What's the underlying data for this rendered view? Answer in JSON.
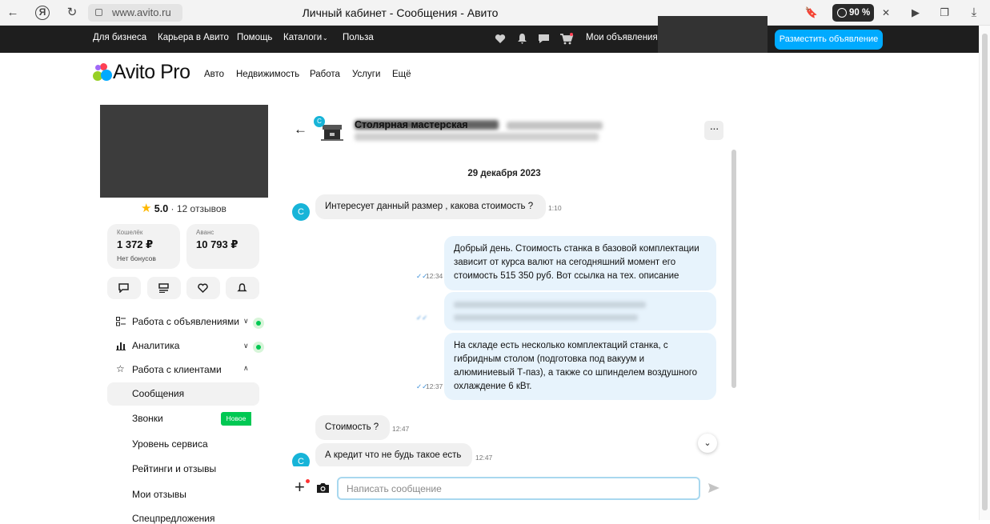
{
  "browser": {
    "url": "www.avito.ru",
    "tab_title": "Личный кабинет - Сообщения - Авито",
    "zoom": "90 %"
  },
  "topnav": {
    "links": [
      "Для бизнеса",
      "Карьера в Авито",
      "Помощь",
      "Каталоги",
      "Польза"
    ],
    "my_ads": "Мои объявления",
    "post_button": "Разместить объявление"
  },
  "header": {
    "logo_text": "Avito Pro",
    "categories": [
      "Авто",
      "Недвижимость",
      "Работа",
      "Услуги",
      "Ещё"
    ]
  },
  "profile": {
    "rating": "5.0",
    "reviews": "12 отзывов",
    "wallet": {
      "label": "Кошелёк",
      "value": "1 372 ₽",
      "sub": "Нет бонусов"
    },
    "advance": {
      "label": "Аванс",
      "value": "10 793 ₽"
    }
  },
  "menu": {
    "ads": "Работа с объявлениями",
    "analytics": "Аналитика",
    "clients": "Работа с клиентами",
    "messages": "Сообщения",
    "calls": "Звонки",
    "new_badge": "Новое",
    "service_level": "Уровень сервиса",
    "ratings": "Рейтинги и отзывы",
    "my_reviews": "Мои отзывы",
    "special": "Спецпредложения"
  },
  "chat": {
    "title": "Столярная мастерская",
    "avatar_letter": "С",
    "date": "29 декабря 2023",
    "messages": [
      {
        "dir": "in",
        "text": "Интересует данный размер , какова стоимость ?",
        "time": "1:10"
      },
      {
        "dir": "out",
        "lines": [
          "Добрый день. Стоимость станка  в базовой комплектации",
          "зависит от курса валют на сегодняшний момент его",
          "стоимость   515 350 руб. Вот  ссылка на тех. описание"
        ],
        "time": "12:34"
      },
      {
        "dir": "out",
        "lines": [
          "На складе есть несколько комплектаций станка, с",
          "гибридным столом (подготовка под вакуум и",
          "алюминиевый Т-паз), а также со шпинделем воздушного",
          "охлаждение 6 кВт."
        ],
        "time": "12:37"
      },
      {
        "dir": "in",
        "text": "Стоимость ?",
        "time": "12:47"
      },
      {
        "dir": "in",
        "text": "А кредит что не будь такое есть",
        "time": "12:47"
      }
    ],
    "input_placeholder": "Написать сообщение"
  }
}
